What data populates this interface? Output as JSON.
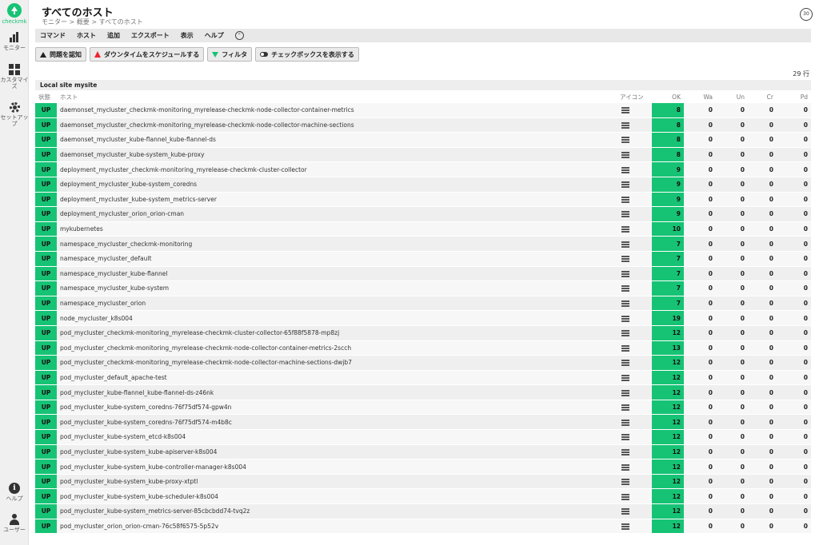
{
  "sidebar": {
    "logo_text": "checkmk",
    "items": [
      {
        "label": "モニター"
      },
      {
        "label": "カスタマイズ"
      },
      {
        "label": "セットアップ"
      },
      {
        "label": "ヘルプ"
      },
      {
        "label": "ユーザー"
      }
    ]
  },
  "header": {
    "title": "すべてのホスト",
    "breadcrumb": "モニター > 概要 > すべてのホスト",
    "reload": "30"
  },
  "menu": [
    "コマンド",
    "ホスト",
    "追加",
    "エクスポート",
    "表示",
    "ヘルプ"
  ],
  "toolbar": {
    "ack": "問題を認知",
    "downtime": "ダウンタイムをスケジュールする",
    "filter": "フィルタ",
    "checkboxes": "チェックボックスを表示する"
  },
  "row_count": "29 行",
  "table": {
    "site": "Local site mysite",
    "columns": {
      "state": "状態",
      "host": "ホスト",
      "icons": "アイコン",
      "ok": "OK",
      "wa": "Wa",
      "un": "Un",
      "cr": "Cr",
      "pd": "Pd"
    },
    "rows": [
      {
        "state": "UP",
        "host": "daemonset_mycluster_checkmk-monitoring_myrelease-checkmk-node-collector-container-metrics",
        "ok": "8",
        "wa": "0",
        "un": "0",
        "cr": "0",
        "pd": "0"
      },
      {
        "state": "UP",
        "host": "daemonset_mycluster_checkmk-monitoring_myrelease-checkmk-node-collector-machine-sections",
        "ok": "8",
        "wa": "0",
        "un": "0",
        "cr": "0",
        "pd": "0"
      },
      {
        "state": "UP",
        "host": "daemonset_mycluster_kube-flannel_kube-flannel-ds",
        "ok": "8",
        "wa": "0",
        "un": "0",
        "cr": "0",
        "pd": "0"
      },
      {
        "state": "UP",
        "host": "daemonset_mycluster_kube-system_kube-proxy",
        "ok": "8",
        "wa": "0",
        "un": "0",
        "cr": "0",
        "pd": "0"
      },
      {
        "state": "UP",
        "host": "deployment_mycluster_checkmk-monitoring_myrelease-checkmk-cluster-collector",
        "ok": "9",
        "wa": "0",
        "un": "0",
        "cr": "0",
        "pd": "0"
      },
      {
        "state": "UP",
        "host": "deployment_mycluster_kube-system_coredns",
        "ok": "9",
        "wa": "0",
        "un": "0",
        "cr": "0",
        "pd": "0"
      },
      {
        "state": "UP",
        "host": "deployment_mycluster_kube-system_metrics-server",
        "ok": "9",
        "wa": "0",
        "un": "0",
        "cr": "0",
        "pd": "0"
      },
      {
        "state": "UP",
        "host": "deployment_mycluster_orion_orion-cman",
        "ok": "9",
        "wa": "0",
        "un": "0",
        "cr": "0",
        "pd": "0"
      },
      {
        "state": "UP",
        "host": "mykubernetes",
        "ok": "10",
        "wa": "0",
        "un": "0",
        "cr": "0",
        "pd": "0"
      },
      {
        "state": "UP",
        "host": "namespace_mycluster_checkmk-monitoring",
        "ok": "7",
        "wa": "0",
        "un": "0",
        "cr": "0",
        "pd": "0"
      },
      {
        "state": "UP",
        "host": "namespace_mycluster_default",
        "ok": "7",
        "wa": "0",
        "un": "0",
        "cr": "0",
        "pd": "0"
      },
      {
        "state": "UP",
        "host": "namespace_mycluster_kube-flannel",
        "ok": "7",
        "wa": "0",
        "un": "0",
        "cr": "0",
        "pd": "0"
      },
      {
        "state": "UP",
        "host": "namespace_mycluster_kube-system",
        "ok": "7",
        "wa": "0",
        "un": "0",
        "cr": "0",
        "pd": "0"
      },
      {
        "state": "UP",
        "host": "namespace_mycluster_orion",
        "ok": "7",
        "wa": "0",
        "un": "0",
        "cr": "0",
        "pd": "0"
      },
      {
        "state": "UP",
        "host": "node_mycluster_k8s004",
        "ok": "19",
        "wa": "0",
        "un": "0",
        "cr": "0",
        "pd": "0"
      },
      {
        "state": "UP",
        "host": "pod_mycluster_checkmk-monitoring_myrelease-checkmk-cluster-collector-65f88f5878-mp8zj",
        "ok": "12",
        "wa": "0",
        "un": "0",
        "cr": "0",
        "pd": "0"
      },
      {
        "state": "UP",
        "host": "pod_mycluster_checkmk-monitoring_myrelease-checkmk-node-collector-container-metrics-2scch",
        "ok": "13",
        "wa": "0",
        "un": "0",
        "cr": "0",
        "pd": "0"
      },
      {
        "state": "UP",
        "host": "pod_mycluster_checkmk-monitoring_myrelease-checkmk-node-collector-machine-sections-dwjb7",
        "ok": "12",
        "wa": "0",
        "un": "0",
        "cr": "0",
        "pd": "0"
      },
      {
        "state": "UP",
        "host": "pod_mycluster_default_apache-test",
        "ok": "12",
        "wa": "0",
        "un": "0",
        "cr": "0",
        "pd": "0"
      },
      {
        "state": "UP",
        "host": "pod_mycluster_kube-flannel_kube-flannel-ds-z46nk",
        "ok": "12",
        "wa": "0",
        "un": "0",
        "cr": "0",
        "pd": "0"
      },
      {
        "state": "UP",
        "host": "pod_mycluster_kube-system_coredns-76f75df574-gpw4n",
        "ok": "12",
        "wa": "0",
        "un": "0",
        "cr": "0",
        "pd": "0"
      },
      {
        "state": "UP",
        "host": "pod_mycluster_kube-system_coredns-76f75df574-m4b8c",
        "ok": "12",
        "wa": "0",
        "un": "0",
        "cr": "0",
        "pd": "0"
      },
      {
        "state": "UP",
        "host": "pod_mycluster_kube-system_etcd-k8s004",
        "ok": "12",
        "wa": "0",
        "un": "0",
        "cr": "0",
        "pd": "0"
      },
      {
        "state": "UP",
        "host": "pod_mycluster_kube-system_kube-apiserver-k8s004",
        "ok": "12",
        "wa": "0",
        "un": "0",
        "cr": "0",
        "pd": "0"
      },
      {
        "state": "UP",
        "host": "pod_mycluster_kube-system_kube-controller-manager-k8s004",
        "ok": "12",
        "wa": "0",
        "un": "0",
        "cr": "0",
        "pd": "0"
      },
      {
        "state": "UP",
        "host": "pod_mycluster_kube-system_kube-proxy-xtptl",
        "ok": "12",
        "wa": "0",
        "un": "0",
        "cr": "0",
        "pd": "0"
      },
      {
        "state": "UP",
        "host": "pod_mycluster_kube-system_kube-scheduler-k8s004",
        "ok": "12",
        "wa": "0",
        "un": "0",
        "cr": "0",
        "pd": "0"
      },
      {
        "state": "UP",
        "host": "pod_mycluster_kube-system_metrics-server-85cbcbdd74-tvq2z",
        "ok": "12",
        "wa": "0",
        "un": "0",
        "cr": "0",
        "pd": "0"
      },
      {
        "state": "UP",
        "host": "pod_mycluster_orion_orion-cman-76c58f6575-5p52v",
        "ok": "12",
        "wa": "0",
        "un": "0",
        "cr": "0",
        "pd": "0"
      }
    ]
  },
  "colors": {
    "ok_green": "#16c374",
    "accent": "#16c374"
  }
}
